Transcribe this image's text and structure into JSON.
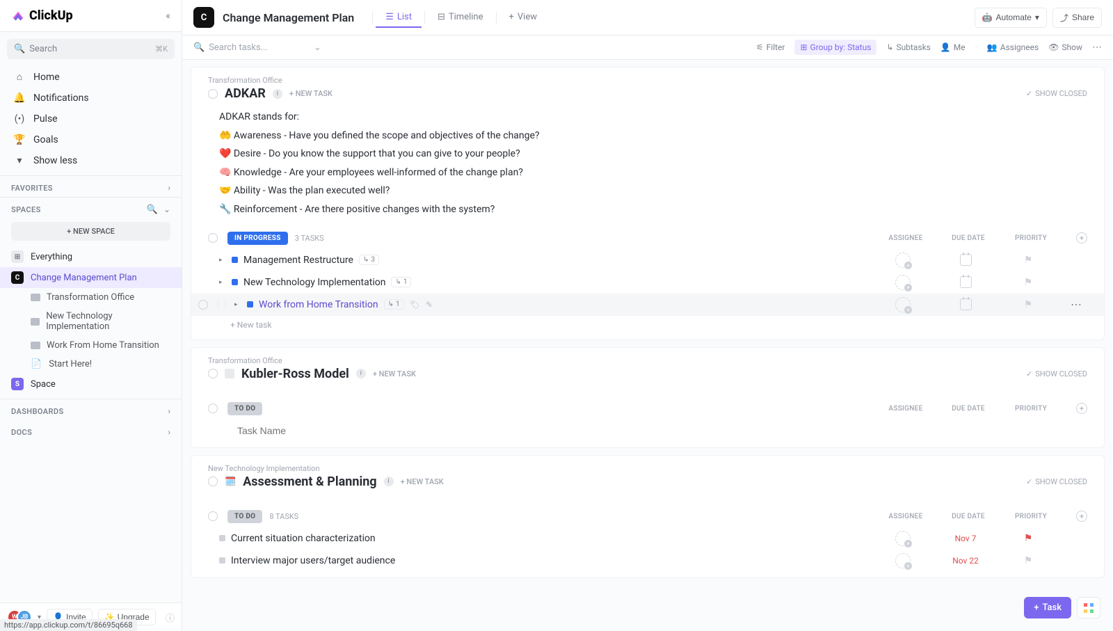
{
  "app": {
    "name": "ClickUp"
  },
  "sidebar": {
    "search": {
      "placeholder": "Search",
      "kbd": "⌘K"
    },
    "nav": [
      {
        "icon": "home",
        "label": "Home"
      },
      {
        "icon": "bell",
        "label": "Notifications"
      },
      {
        "icon": "pulse",
        "label": "Pulse"
      },
      {
        "icon": "trophy",
        "label": "Goals"
      },
      {
        "icon": "chevdown",
        "label": "Show less"
      }
    ],
    "favorites_label": "FAVORITES",
    "spaces_label": "SPACES",
    "new_space": "+  NEW SPACE",
    "spaces": [
      {
        "icon": "grid",
        "label": "Everything",
        "color": "#b9bec7"
      },
      {
        "icon": "C",
        "label": "Change Management Plan",
        "color": "#111",
        "active": true
      },
      {
        "child": true,
        "label": "Transformation Office"
      },
      {
        "child": true,
        "label": "New Technology Implementation"
      },
      {
        "child": true,
        "label": "Work From Home Transition"
      },
      {
        "child": true,
        "doc": true,
        "label": "Start Here!"
      },
      {
        "icon": "S",
        "label": "Space",
        "color": "#7b68ee"
      }
    ],
    "dashboards_label": "DASHBOARDS",
    "docs_label": "DOCS",
    "invite": "Invite",
    "upgrade": "Upgrade",
    "avatars": [
      {
        "label": "W",
        "color": "#d93f3f"
      },
      {
        "label": "JB",
        "color": "#4f9ee0"
      }
    ]
  },
  "topbar": {
    "project_icon": "C",
    "project_title": "Change Management Plan",
    "tabs": [
      {
        "label": "List",
        "active": true
      },
      {
        "label": "Timeline"
      },
      {
        "label": "View",
        "add": true
      }
    ],
    "automate": "Automate",
    "share": "Share"
  },
  "filterbar": {
    "search_placeholder": "Search tasks...",
    "filter": "Filter",
    "group": "Group by: Status",
    "subtasks": "Subtasks",
    "me": "Me",
    "assignees": "Assignees",
    "show": "Show"
  },
  "columns": {
    "assignee": "ASSIGNEE",
    "due": "DUE DATE",
    "priority": "PRIORITY"
  },
  "sections": [
    {
      "breadcrumb": "Transformation Office",
      "title": "ADKAR",
      "new_task": "+ NEW TASK",
      "show_closed": "SHOW CLOSED",
      "description": [
        "ADKAR stands for:",
        "🤲 Awareness - Have you defined the scope and objectives of the change?",
        "❤️ Desire - Do you know the support that you can give to your people?",
        "🧠 Knowledge - Are your employees well-informed of the change plan?",
        "🤝 Ability - Was the plan executed well?",
        "🔧 Reinforcement - Are there positive changes with the system?"
      ],
      "groups": [
        {
          "status": "IN PROGRESS",
          "style": "progress",
          "count": "3 TASKS",
          "tasks": [
            {
              "name": "Management Restructure",
              "sub": "3",
              "dot": "blue"
            },
            {
              "name": "New Technology Implementation",
              "sub": "1",
              "dot": "blue"
            },
            {
              "name": "Work from Home Transition",
              "sub": "1",
              "dot": "blue",
              "selected": true,
              "link": true
            }
          ],
          "new_task": "+ New task"
        }
      ]
    },
    {
      "breadcrumb": "Transformation Office",
      "title": "Kubler-Ross Model",
      "gray_square": true,
      "new_task": "+ NEW TASK",
      "show_closed": "SHOW CLOSED",
      "groups": [
        {
          "status": "TO DO",
          "style": "todo",
          "count": "",
          "input_placeholder": "Task Name"
        }
      ]
    },
    {
      "breadcrumb": "New Technology Implementation",
      "emoji": "🗓️",
      "title": "Assessment & Planning",
      "new_task": "+ NEW TASK",
      "show_closed": "SHOW CLOSED",
      "groups": [
        {
          "status": "TO DO",
          "style": "todo",
          "count": "8 TASKS",
          "tasks": [
            {
              "name": "Current situation characterization",
              "dot": "gray",
              "due": "Nov 7",
              "due_red": true,
              "flag_red": true
            },
            {
              "name": "Interview major users/target audience",
              "dot": "gray",
              "due": "Nov 22",
              "due_red": true
            }
          ]
        }
      ]
    }
  ],
  "fab": {
    "task": "Task"
  },
  "status_url": "https://app.clickup.com/t/86695q668"
}
